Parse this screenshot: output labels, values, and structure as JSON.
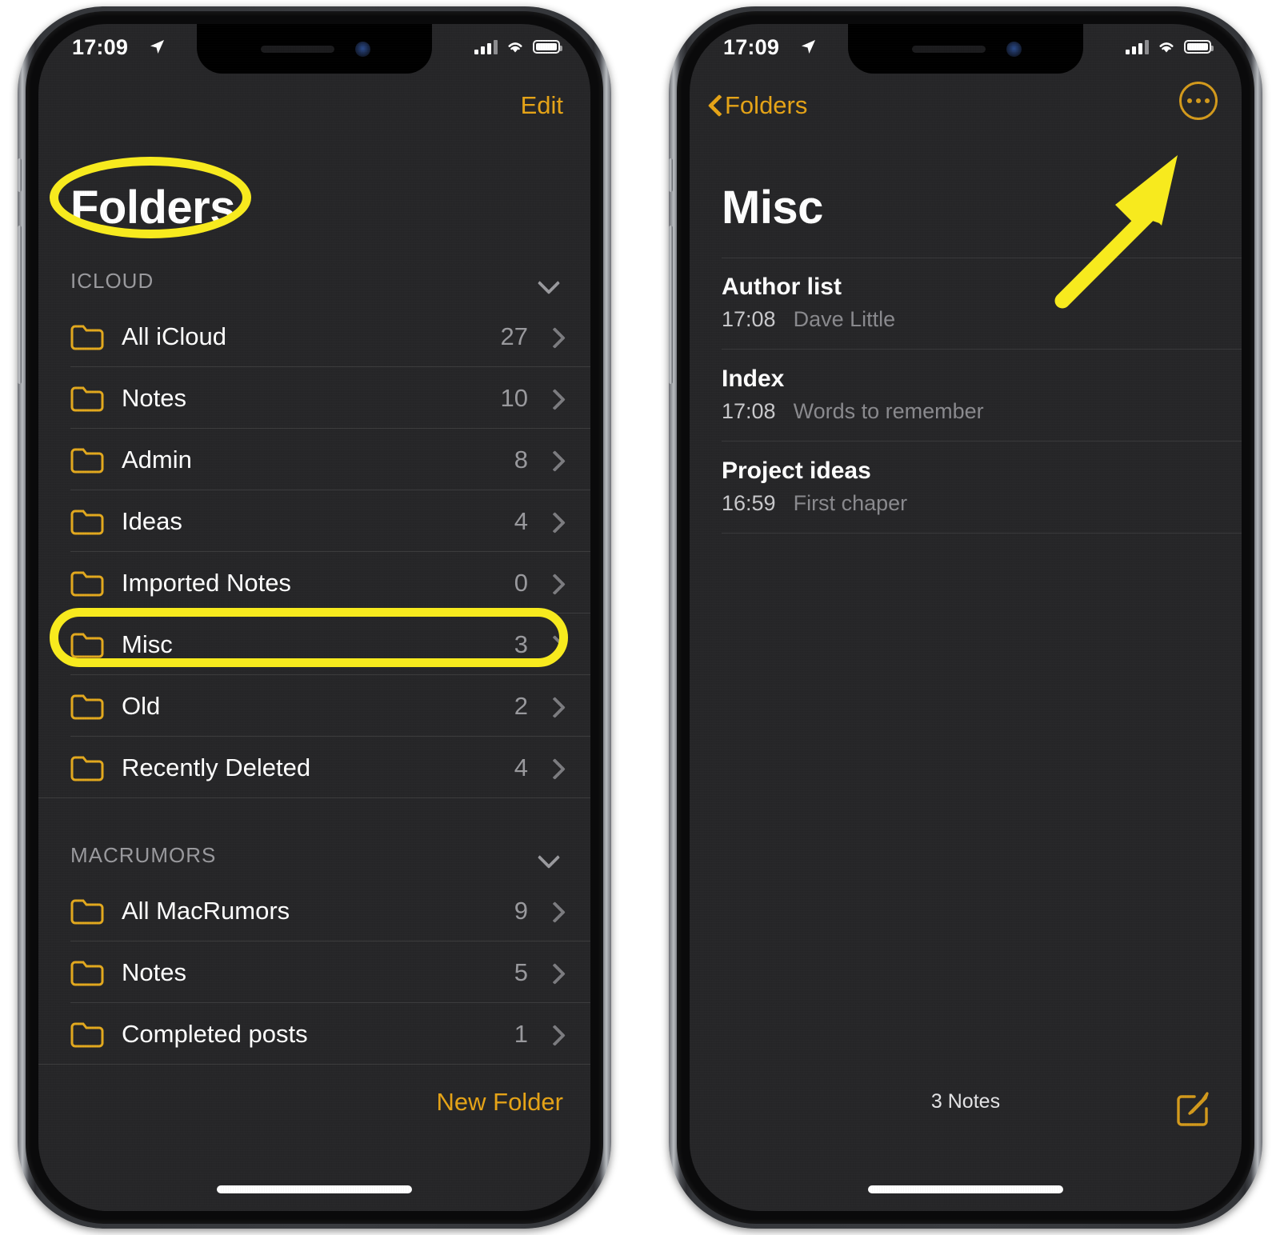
{
  "status_bar": {
    "time": "17:09",
    "location_icon": "location-arrow-icon",
    "cellular_icon": "cellular-bars-icon",
    "wifi_icon": "wifi-icon",
    "battery_icon": "battery-full-icon"
  },
  "left_phone": {
    "nav": {
      "edit_label": "Edit"
    },
    "title": "Folders",
    "sections": [
      {
        "header": "ICLOUD",
        "collapse_icon": "chevron-down-icon",
        "rows": [
          {
            "label": "All iCloud",
            "count": "27"
          },
          {
            "label": "Notes",
            "count": "10"
          },
          {
            "label": "Admin",
            "count": "8"
          },
          {
            "label": "Ideas",
            "count": "4"
          },
          {
            "label": "Imported Notes",
            "count": "0"
          },
          {
            "label": "Misc",
            "count": "3"
          },
          {
            "label": "Old",
            "count": "2"
          },
          {
            "label": "Recently Deleted",
            "count": "4"
          }
        ]
      },
      {
        "header": "MACRUMORS",
        "collapse_icon": "chevron-down-icon",
        "rows": [
          {
            "label": "All MacRumors",
            "count": "9"
          },
          {
            "label": "Notes",
            "count": "5"
          },
          {
            "label": "Completed posts",
            "count": "1"
          }
        ]
      }
    ],
    "new_folder_label": "New Folder"
  },
  "right_phone": {
    "nav": {
      "back_label": "Folders",
      "back_icon": "chevron-left-icon",
      "more_icon": "ellipsis-circle-icon"
    },
    "title": "Misc",
    "notes": [
      {
        "title": "Author list",
        "time": "17:08",
        "preview": "Dave Little"
      },
      {
        "title": "Index",
        "time": "17:08",
        "preview": "Words to remember"
      },
      {
        "title": "Project ideas",
        "time": "16:59",
        "preview": "First chaper"
      }
    ],
    "footer_count": "3 Notes",
    "compose_icon": "compose-note-icon"
  },
  "annotations": {
    "highlight_color": "#F7EA1E",
    "title_ellipse": "folders-title-highlight",
    "row_rect": "misc-row-highlight",
    "arrow": "pointer-arrow-to-more-button"
  },
  "colors": {
    "accent": "#E6A417",
    "folder_icon": "#E3A91E",
    "screen_bg": "#262628",
    "text_primary": "#FFFFFF",
    "text_secondary": "#9A9A9E"
  }
}
